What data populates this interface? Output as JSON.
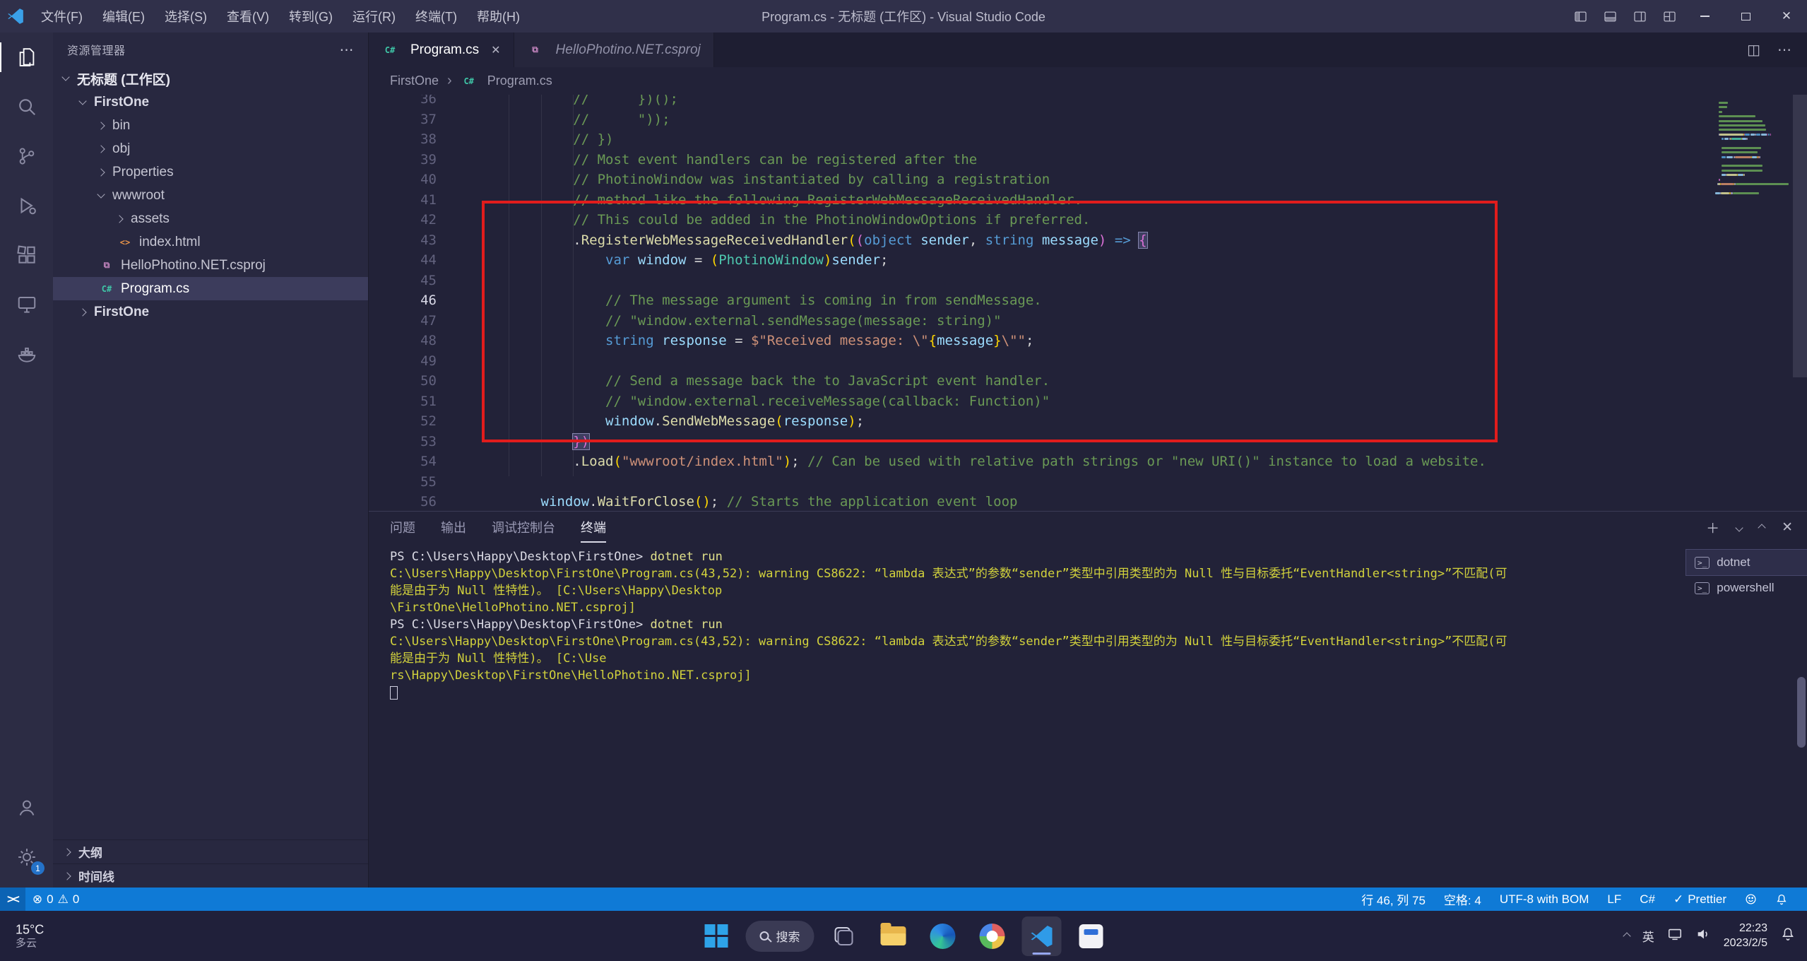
{
  "window": {
    "title": "Program.cs - 无标题 (工作区) - Visual Studio Code",
    "menus": [
      "文件(F)",
      "编辑(E)",
      "选择(S)",
      "查看(V)",
      "转到(G)",
      "运行(R)",
      "终端(T)",
      "帮助(H)"
    ]
  },
  "activity_bar": {
    "settings_badge": "1"
  },
  "explorer": {
    "title": "资源管理器",
    "workspace": "无标题 (工作区)",
    "items": [
      {
        "label": "FirstOne",
        "depth": 1,
        "chevron": "down",
        "bold": true
      },
      {
        "label": "bin",
        "depth": 2,
        "chevron": "right"
      },
      {
        "label": "obj",
        "depth": 2,
        "chevron": "right"
      },
      {
        "label": "Properties",
        "depth": 2,
        "chevron": "right"
      },
      {
        "label": "wwwroot",
        "depth": 2,
        "chevron": "down"
      },
      {
        "label": "assets",
        "depth": 3,
        "chevron": "right"
      },
      {
        "label": "index.html",
        "depth": 3,
        "icon": "html"
      },
      {
        "label": "HelloPhotino.NET.csproj",
        "depth": 2,
        "icon": "csproj"
      },
      {
        "label": "Program.cs",
        "depth": 2,
        "icon": "cs",
        "selected": true
      },
      {
        "label": "FirstOne",
        "depth": 1,
        "chevron": "right",
        "bold": true
      }
    ],
    "sections": [
      "大纲",
      "时间线"
    ]
  },
  "tabs": [
    {
      "label": "Program.cs",
      "icon": "cs",
      "active": true
    },
    {
      "label": "HelloPhotino.NET.csproj",
      "icon": "csproj",
      "italic": true
    }
  ],
  "breadcrumb": {
    "items": [
      "FirstOne",
      "Program.cs"
    ],
    "separator": "›"
  },
  "editor": {
    "lines": [
      {
        "n": 36,
        "tokens": [
          [
            "cm",
            "            //      })();"
          ]
        ]
      },
      {
        "n": 37,
        "tokens": [
          [
            "cm",
            "            //      \"));"
          ]
        ]
      },
      {
        "n": 38,
        "tokens": [
          [
            "cm",
            "            // })"
          ]
        ]
      },
      {
        "n": 39,
        "tokens": [
          [
            "cm",
            "            // Most event handlers can be registered after the"
          ]
        ]
      },
      {
        "n": 40,
        "tokens": [
          [
            "cm",
            "            // PhotinoWindow was instantiated by calling a registration"
          ]
        ]
      },
      {
        "n": 41,
        "tokens": [
          [
            "cm",
            "            // method like the following RegisterWebMessageReceivedHandler."
          ]
        ]
      },
      {
        "n": 42,
        "tokens": [
          [
            "cm",
            "            // This could be added in the PhotinoWindowOptions if preferred."
          ]
        ]
      },
      {
        "n": 43,
        "tokens": [
          [
            "p",
            "            ."
          ],
          [
            "m",
            "RegisterWebMessageReceivedHandler"
          ],
          [
            "b1",
            "("
          ],
          [
            "b2",
            "("
          ],
          [
            "k",
            "object"
          ],
          [
            "p",
            " "
          ],
          [
            "v",
            "sender"
          ],
          [
            "p",
            ", "
          ],
          [
            "k",
            "string"
          ],
          [
            "p",
            " "
          ],
          [
            "v",
            "message"
          ],
          [
            "b2",
            ")"
          ],
          [
            "p",
            " "
          ],
          [
            "k",
            "=>"
          ],
          [
            "p",
            " "
          ],
          [
            "hl",
            "{"
          ]
        ]
      },
      {
        "n": 44,
        "tokens": [
          [
            "p",
            "                "
          ],
          [
            "k",
            "var"
          ],
          [
            "p",
            " "
          ],
          [
            "v",
            "window"
          ],
          [
            "p",
            " = "
          ],
          [
            "b1",
            "("
          ],
          [
            "t",
            "PhotinoWindow"
          ],
          [
            "b1",
            ")"
          ],
          [
            "v",
            "sender"
          ],
          [
            "p",
            ";"
          ]
        ]
      },
      {
        "n": 45,
        "tokens": []
      },
      {
        "n": 46,
        "current": true,
        "tokens": [
          [
            "cm",
            "                // The message argument is coming in from sendMessage."
          ]
        ]
      },
      {
        "n": 47,
        "tokens": [
          [
            "cm",
            "                // \"window.external.sendMessage(message: string)\""
          ]
        ]
      },
      {
        "n": 48,
        "tokens": [
          [
            "p",
            "                "
          ],
          [
            "k",
            "string"
          ],
          [
            "p",
            " "
          ],
          [
            "v",
            "response"
          ],
          [
            "p",
            " = "
          ],
          [
            "s",
            "$\"Received message: \\\""
          ],
          [
            "b1",
            "{"
          ],
          [
            "v",
            "message"
          ],
          [
            "b1",
            "}"
          ],
          [
            "s",
            "\\\"\""
          ],
          [
            "p",
            ";"
          ]
        ]
      },
      {
        "n": 49,
        "tokens": []
      },
      {
        "n": 50,
        "tokens": [
          [
            "cm",
            "                // Send a message back the to JavaScript event handler."
          ]
        ]
      },
      {
        "n": 51,
        "tokens": [
          [
            "cm",
            "                // \"window.external.receiveMessage(callback: Function)\""
          ]
        ]
      },
      {
        "n": 52,
        "tokens": [
          [
            "p",
            "                "
          ],
          [
            "v",
            "window"
          ],
          [
            "p",
            "."
          ],
          [
            "m",
            "SendWebMessage"
          ],
          [
            "b1",
            "("
          ],
          [
            "v",
            "response"
          ],
          [
            "b1",
            ")"
          ],
          [
            "p",
            ";"
          ]
        ]
      },
      {
        "n": 53,
        "tokens": [
          [
            "p",
            "            "
          ],
          [
            "hl",
            "})"
          ]
        ]
      },
      {
        "n": 54,
        "tokens": [
          [
            "p",
            "            ."
          ],
          [
            "m",
            "Load"
          ],
          [
            "b1",
            "("
          ],
          [
            "s",
            "\"wwwroot/index.html\""
          ],
          [
            "b1",
            ")"
          ],
          [
            "p",
            "; "
          ],
          [
            "cm",
            "// Can be used with relative path strings or \"new URI()\" instance to load a website."
          ]
        ]
      },
      {
        "n": 55,
        "tokens": []
      },
      {
        "n": 56,
        "tokens": [
          [
            "p",
            "        "
          ],
          [
            "v",
            "window"
          ],
          [
            "p",
            "."
          ],
          [
            "m",
            "WaitForClose"
          ],
          [
            "b1",
            "("
          ],
          [
            "b1",
            ")"
          ],
          [
            "p",
            "; "
          ],
          [
            "cm",
            "// Starts the application event loop"
          ]
        ]
      }
    ]
  },
  "panel": {
    "tabs": [
      {
        "label": "问题"
      },
      {
        "label": "输出"
      },
      {
        "label": "调试控制台"
      },
      {
        "label": "终端",
        "active": true
      }
    ],
    "terminal": {
      "lines": [
        {
          "tokens": [
            [
              "w",
              "PS C:\\Users\\Happy\\Desktop\\FirstOne> "
            ],
            [
              "y",
              "dotnet run"
            ]
          ]
        },
        {
          "tokens": [
            [
              "warn",
              "C:\\Users\\Happy\\Desktop\\FirstOne\\Program.cs(43,52): warning CS8622: “lambda 表达式”的参数“sender”类型中引用类型的为 Null 性与目标委托“EventHandler<string>”不匹配(可"
            ]
          ]
        },
        {
          "tokens": [
            [
              "warn",
              "能是由于为 Null 性特性)。 [C:\\Users\\Happy\\Desktop"
            ]
          ]
        },
        {
          "tokens": [
            [
              "warn",
              "\\FirstOne\\HelloPhotino.NET.csproj]"
            ]
          ]
        },
        {
          "tokens": [
            [
              "w",
              "PS C:\\Users\\Happy\\Desktop\\FirstOne> "
            ],
            [
              "y",
              "dotnet run"
            ]
          ]
        },
        {
          "tokens": [
            [
              "warn",
              "C:\\Users\\Happy\\Desktop\\FirstOne\\Program.cs(43,52): warning CS8622: “lambda 表达式”的参数“sender”类型中引用类型的为 Null 性与目标委托“EventHandler<string>”不匹配(可"
            ]
          ]
        },
        {
          "tokens": [
            [
              "warn",
              "能是由于为 Null 性特性)。 [C:\\Use"
            ]
          ]
        },
        {
          "tokens": [
            [
              "warn",
              "rs\\Happy\\Desktop\\FirstOne\\HelloPhotino.NET.csproj]"
            ]
          ]
        },
        {
          "tokens": [
            [
              "cursor",
              ""
            ]
          ]
        }
      ],
      "processes": [
        {
          "label": "dotnet",
          "selected": true
        },
        {
          "label": "powershell"
        }
      ]
    }
  },
  "status_bar": {
    "errors": "0",
    "warnings": "0",
    "cursor_position": "行 46, 列 75",
    "indentation": "空格: 4",
    "encoding": "UTF-8 with BOM",
    "eol": "LF",
    "language": "C#",
    "formatter": "Prettier"
  },
  "taskbar": {
    "weather_temp": "15°C",
    "weather_desc": "多云",
    "search_label": "搜索",
    "ime": "英",
    "time": "22:23",
    "date": "2023/2/5"
  }
}
